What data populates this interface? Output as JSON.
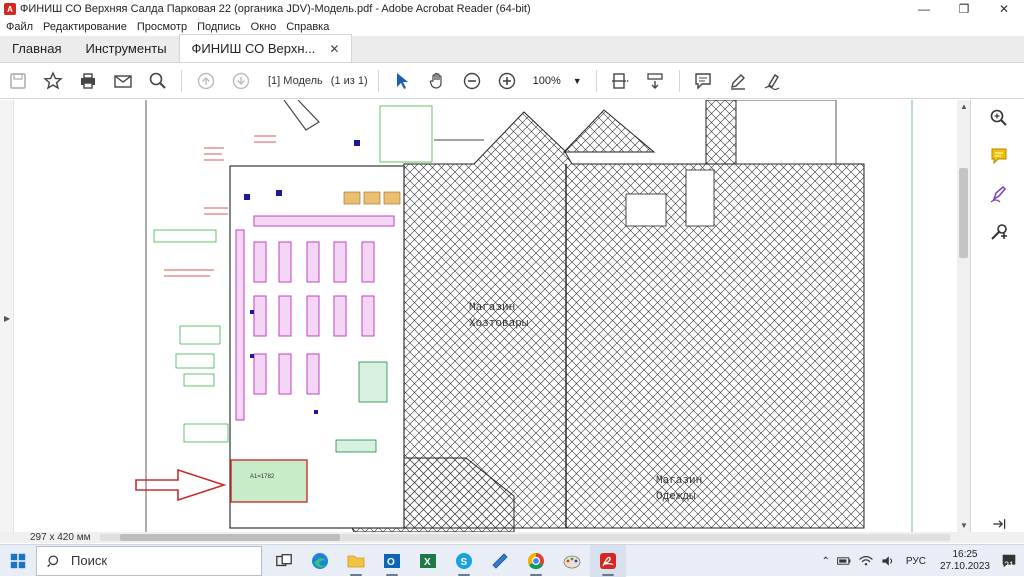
{
  "window": {
    "title": "ФИНИШ СО Верхняя Салда Парковая 22 (органика JDV)-Модель.pdf - Adobe Acrobat Reader (64-bit)",
    "minimize": "—",
    "restore": "❐",
    "close": "✕"
  },
  "menu": [
    "Файл",
    "Редактирование",
    "Просмотр",
    "Подпись",
    "Окно",
    "Справка"
  ],
  "tabs": {
    "home": "Главная",
    "tools": "Инструменты",
    "doc": "ФИНИШ СО Верхн...",
    "close": "✕"
  },
  "toolbar": {
    "page_label": "[1] Модель",
    "page_count": "(1 из 1)",
    "zoom": "100%"
  },
  "drawing": {
    "store_household_line1": "Магазин",
    "store_household_line2": "Хозтовары",
    "store_clothes_line1": "Магазин",
    "store_clothes_line2": "Одежды",
    "area_label": "А1=1782"
  },
  "status": {
    "page_size": "297 x 420 мм"
  },
  "taskbar": {
    "search_placeholder": "Поиск",
    "lang": "РУС",
    "time": "16:25",
    "date": "27.10.2023",
    "notifications": "21"
  },
  "colors": {
    "accent_red": "#d4271f",
    "plan_magenta": "#c040c0",
    "plan_green": "#22aa33",
    "plan_red": "#cc2222"
  }
}
